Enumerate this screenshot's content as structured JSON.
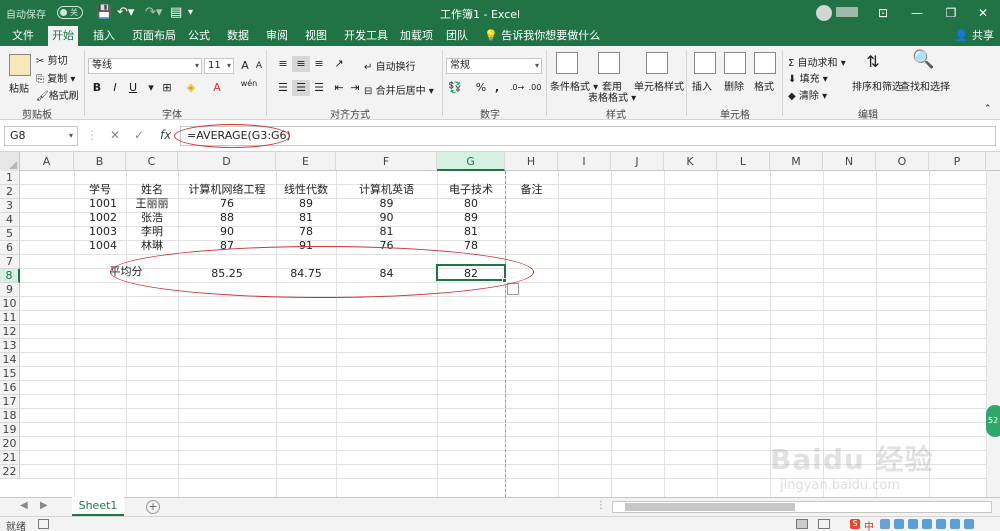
{
  "titlebar": {
    "autosave_label": "自动保存",
    "autosave_state": "关",
    "document_title": "工作簿1 - Excel"
  },
  "tabs": [
    "文件",
    "开始",
    "插入",
    "页面布局",
    "公式",
    "数据",
    "审阅",
    "视图",
    "开发工具",
    "加载项",
    "团队"
  ],
  "active_tab": "开始",
  "tell_me": "告诉我你想要做什么",
  "share": "共享",
  "ribbon": {
    "clipboard": {
      "paste": "粘贴",
      "cut": "剪切",
      "copy": "复制",
      "format_painter": "格式刷",
      "label": "剪贴板"
    },
    "font": {
      "font_name": "等线",
      "font_size": "11",
      "bold": "B",
      "italic": "I",
      "underline": "U",
      "grow": "A",
      "shrink": "A",
      "wen": "wén",
      "label": "字体"
    },
    "alignment": {
      "wrap_text": "自动换行",
      "merge_center": "合并后居中",
      "label": "对齐方式"
    },
    "number": {
      "format": "常规",
      "percent": "%",
      "comma": ",",
      "label": "数字"
    },
    "styles": {
      "conditional": "条件格式",
      "table_format_1": "套用",
      "table_format_2": "表格格式",
      "cell_styles": "单元格样式",
      "label": "样式"
    },
    "cells": {
      "insert": "插入",
      "delete": "删除",
      "format": "格式",
      "label": "单元格"
    },
    "editing": {
      "autosum": "自动求和",
      "fill": "填充",
      "clear": "清除",
      "sort_filter": "排序和筛选",
      "find_select": "查找和选择",
      "label": "编辑"
    }
  },
  "formula_bar": {
    "name_box": "G8",
    "formula": "=AVERAGE(G3:G6)",
    "cancel_icon": "✕",
    "enter_icon": "✓",
    "fx_icon": "fx"
  },
  "columns": [
    "A",
    "B",
    "C",
    "D",
    "E",
    "F",
    "G",
    "H",
    "I",
    "J",
    "K",
    "L",
    "M",
    "N",
    "O",
    "P"
  ],
  "rows": [
    "1",
    "2",
    "3",
    "4",
    "5",
    "6",
    "7",
    "8",
    "9",
    "10",
    "11",
    "12",
    "13",
    "14",
    "15",
    "16",
    "17",
    "18",
    "19",
    "20",
    "21",
    "22"
  ],
  "table": {
    "headers": [
      "学号",
      "姓名",
      "计算机网络工程",
      "线性代数",
      "计算机英语",
      "电子技术",
      "备注"
    ],
    "records": [
      [
        "1001",
        "王丽丽",
        "76",
        "89",
        "89",
        "80"
      ],
      [
        "1002",
        "张浩",
        "88",
        "81",
        "90",
        "89"
      ],
      [
        "1003",
        "李明",
        "90",
        "78",
        "81",
        "81"
      ],
      [
        "1004",
        "林琳",
        "87",
        "91",
        "76",
        "78"
      ]
    ],
    "average_label": "平均分",
    "averages": [
      "85.25",
      "84.75",
      "84",
      "82"
    ]
  },
  "sheet_tabs": [
    "Sheet1"
  ],
  "status": {
    "ready": "就绪"
  },
  "tray": {
    "ime": "S",
    "ime_mode": "中"
  },
  "watermark": {
    "brand": "Baidu 经验",
    "url": "jingyan.baidu.com"
  },
  "badge": "52"
}
